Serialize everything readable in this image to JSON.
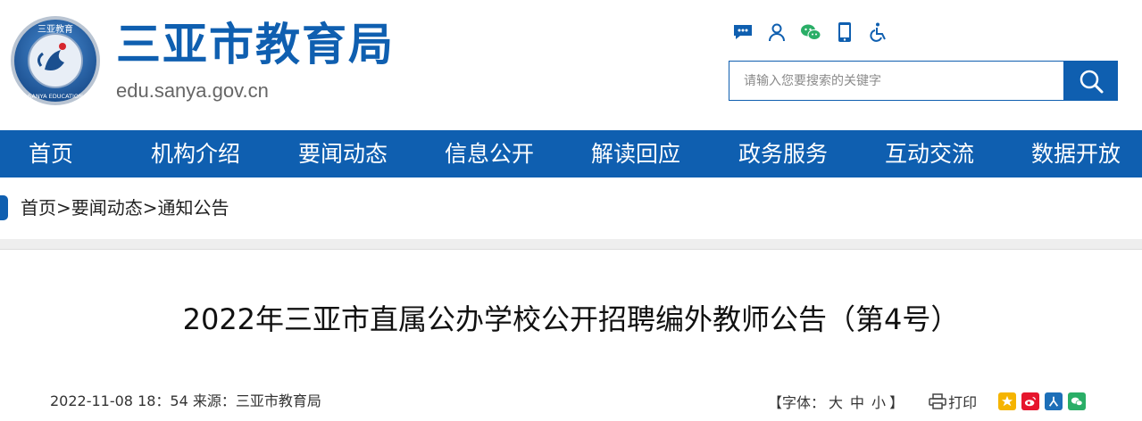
{
  "header": {
    "site_title": "三亚市教育局",
    "site_domain": "edu.sanya.gov.cn",
    "logo": {
      "icon": "sanya-education-emblem-icon",
      "top_text": "三亚教育",
      "bottom_text": "SANYA EDUCATION"
    },
    "tools": [
      {
        "name": "message-icon"
      },
      {
        "name": "user-icon"
      },
      {
        "name": "wechat-icon"
      },
      {
        "name": "mobile-icon"
      },
      {
        "name": "accessibility-icon"
      }
    ],
    "search": {
      "placeholder": "请输入您要搜索的关键字",
      "value": "",
      "button_icon": "search-icon"
    }
  },
  "nav": {
    "items": [
      {
        "label": "首页"
      },
      {
        "label": "机构介绍"
      },
      {
        "label": "要闻动态"
      },
      {
        "label": "信息公开"
      },
      {
        "label": "解读回应"
      },
      {
        "label": "政务服务"
      },
      {
        "label": "互动交流"
      },
      {
        "label": "数据开放"
      }
    ]
  },
  "breadcrumb": {
    "items": [
      "首页",
      "要闻动态",
      "通知公告"
    ],
    "separator": ">"
  },
  "article": {
    "title": "2022年三亚市直属公办学校公开招聘编外教师公告（第4号）",
    "date": "2022-11-08 18：54",
    "source_label": "来源：",
    "source": "三亚市教育局",
    "font_label_open": "【字体：",
    "font_large": "大",
    "font_medium": "中",
    "font_small": "小",
    "font_label_close": "】",
    "print_label": "打印",
    "share": [
      {
        "name": "qzone-share-icon",
        "color": "#f5b400"
      },
      {
        "name": "weibo-share-icon",
        "color": "#e6162d"
      },
      {
        "name": "renren-share-icon",
        "color": "#1d6fb8"
      },
      {
        "name": "wechat-share-icon",
        "color": "#2aae67"
      }
    ]
  },
  "colors": {
    "brand": "#0f5fb0",
    "band": "#eeeeee"
  }
}
